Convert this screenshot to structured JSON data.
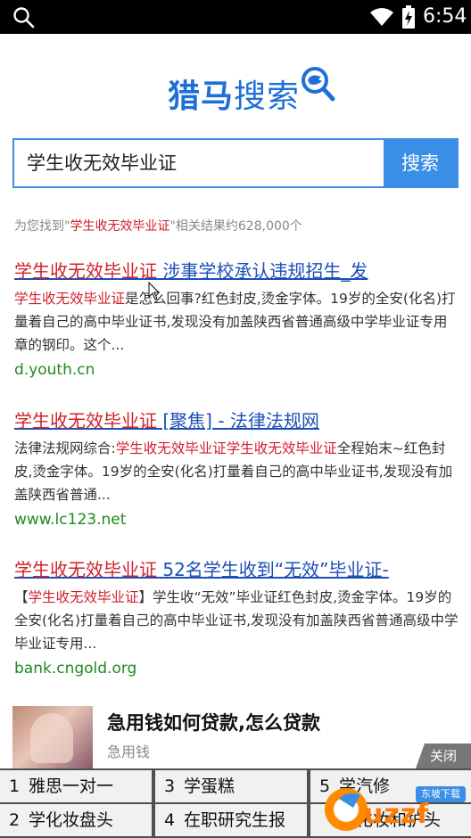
{
  "statusbar": {
    "time": "6:54"
  },
  "logo": {
    "part1": "猎马",
    "part2": "搜索"
  },
  "search": {
    "query": "学生收无效毕业证",
    "button_label": "搜索"
  },
  "result_count": {
    "prefix": "为您找到\"",
    "keyword": "学生收无效毕业证",
    "suffix": "\"相关结果约628,000个"
  },
  "results": [
    {
      "title_kw": "学生收无效毕业证",
      "title_rest": " 涉事学校承认违规招生_发",
      "snippet_kw": "学生收无效毕业证",
      "snippet_rest": "是怎么回事?红色封皮,烫金字体。19岁的全安(化名)打量着自己的高中毕业证书,发现没有加盖陕西省普通高级中学毕业证专用章的钢印。这个...",
      "url": "d.youth.cn"
    },
    {
      "title_kw": "学生收无效毕业证",
      "title_rest": " [聚焦] - 法律法规网",
      "snippet_pre": "法律法规网综合:",
      "snippet_kw": "学生收无效毕业证学生收无效毕业证",
      "snippet_rest": "全程始末~红色封皮,烫金字体。19岁的全安(化名)打量着自己的高中毕业证书,发现没有加盖陕西省普通...",
      "url": "www.lc123.net"
    },
    {
      "title_kw": "学生收无效毕业证",
      "title_rest": " 52名学生收到“无效”毕业证-",
      "snippet_pre": "【",
      "snippet_kw": "学生收无效毕业证",
      "snippet_rest": "】学生收“无效”毕业证红色封皮,烫金字体。19岁的全安(化名)打量着自己的高中毕业证书,发现没有加盖陕西省普通高级中学毕业证专用...",
      "url": "bank.cngold.org"
    }
  ],
  "ad": {
    "title": "急用钱如何贷款,怎么贷款",
    "subtitle": "急用钱",
    "close_label": "关闭"
  },
  "hot": [
    {
      "n": "1",
      "label": "雅思一对一"
    },
    {
      "n": "3",
      "label": "学蛋糕"
    },
    {
      "n": "5",
      "label": "学汽修"
    },
    {
      "n": "2",
      "label": "学化妆盘头"
    },
    {
      "n": "4",
      "label": "在职研究生报"
    },
    {
      "n": "",
      "label": "学化妆和护头"
    }
  ],
  "watermark": {
    "brand": "uzzf",
    "tag": "东坡下载"
  },
  "colors": {
    "accent": "#3a8ee6",
    "keyword": "#d0202a",
    "link": "#1a4fb8",
    "url": "#1f8a1f"
  }
}
